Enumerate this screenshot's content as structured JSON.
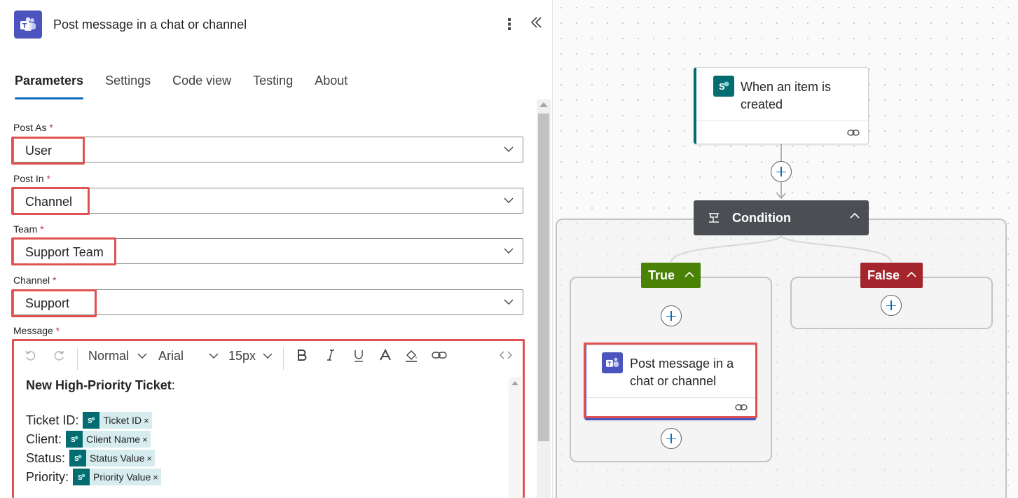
{
  "panel": {
    "title": "Post message in a chat or channel",
    "tabs": [
      "Parameters",
      "Settings",
      "Code view",
      "Testing",
      "About"
    ],
    "active_tab": "Parameters"
  },
  "fields": {
    "post_as": {
      "label": "Post As",
      "required_mark": "*",
      "value": "User"
    },
    "post_in": {
      "label": "Post In",
      "required_mark": "*",
      "value": "Channel"
    },
    "team": {
      "label": "Team",
      "required_mark": "*",
      "value": "Support Team"
    },
    "channel": {
      "label": "Channel",
      "required_mark": "*",
      "value": "Support"
    },
    "message": {
      "label": "Message",
      "required_mark": "*"
    }
  },
  "editor": {
    "style_select": "Normal",
    "font_select": "Arial",
    "size_select": "15px",
    "heading_bold": "New High-Priority Ticket",
    "heading_suffix": ":",
    "lines": [
      {
        "label": "Ticket ID:",
        "token": "Ticket ID"
      },
      {
        "label": "Client:",
        "token": "Client Name"
      },
      {
        "label": "Status:",
        "token": "Status Value"
      },
      {
        "label": "Priority:",
        "token": "Priority Value"
      }
    ],
    "token_remove": "×"
  },
  "flow": {
    "trigger": {
      "title": "When an item is created",
      "line1": "When an item is",
      "line2": "created"
    },
    "condition": {
      "title": "Condition"
    },
    "true_branch": {
      "label": "True",
      "color": "#498205"
    },
    "false_branch": {
      "label": "False",
      "color": "#a4262c"
    },
    "action": {
      "title": "Post message in a chat or channel",
      "line1": "Post message in a",
      "line2": "chat or channel"
    }
  },
  "colors": {
    "accent": "#0f6cbd",
    "highlight": "#e05252",
    "sharepoint": "#036c70",
    "teams": "#4b53bc"
  }
}
